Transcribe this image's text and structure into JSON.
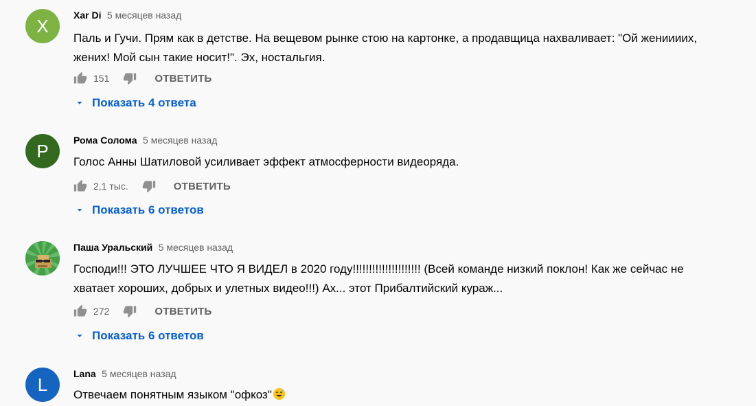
{
  "comments": [
    {
      "avatar_letter": "X",
      "avatar_color": "#7cb342",
      "author": "Xar Di",
      "time": "5 месяцев назад",
      "text_lines": [
        "Паль и Гучи. Прям как в детстве. На вещевом рынке стою на картонке, а продавщица нахваливает: \"Ой жениииих,",
        "жених! Мой сын такие носит!\". Эх, ностальгия."
      ],
      "likes": "151",
      "reply_label": "ОТВЕТИТЬ",
      "show_replies": "Показать 4 ответа"
    },
    {
      "avatar_letter": "P",
      "avatar_color": "#33691e",
      "author": "Рома Солома",
      "time": "5 месяцев назад",
      "text_lines": [
        "Голос Анны Шатиловой усиливает эффект атмосферности видеоряда."
      ],
      "likes": "2,1 тыс.",
      "reply_label": "ОТВЕТИТЬ",
      "show_replies": "Показать 6 ответов"
    },
    {
      "avatar_letter": "",
      "avatar_color": "#4caf50",
      "author": "Паша Уральский",
      "time": "5 месяцев назад",
      "text_lines": [
        "Господи!!! ЭТО ЛУЧШЕЕ ЧТО Я ВИДЕЛ в 2020 году!!!!!!!!!!!!!!!!!!!!! (Всей команде низкий поклон! Как же сейчас не",
        "хватает хороших, добрых и улетных видео!!!) Ах... этот Прибалтийский кураж..."
      ],
      "likes": "272",
      "reply_label": "ОТВЕТИТЬ",
      "show_replies": "Показать 6 ответов"
    },
    {
      "avatar_letter": "L",
      "avatar_color": "#1565c0",
      "author": "Lana",
      "time": "5 месяцев назад",
      "text_lines": [
        "Отвечаем понятным языком \"офкоз\""
      ],
      "likes": "",
      "reply_label": "",
      "show_replies": ""
    }
  ],
  "icons": {
    "like": "thumb-up-icon",
    "dislike": "thumb-down-icon",
    "caret": "caret-down-icon",
    "emoji": "sweat-smile-emoji-icon"
  },
  "colors": {
    "link_blue": "#065fd4",
    "secondary_text": "#606060",
    "icon_gray": "#909090"
  }
}
